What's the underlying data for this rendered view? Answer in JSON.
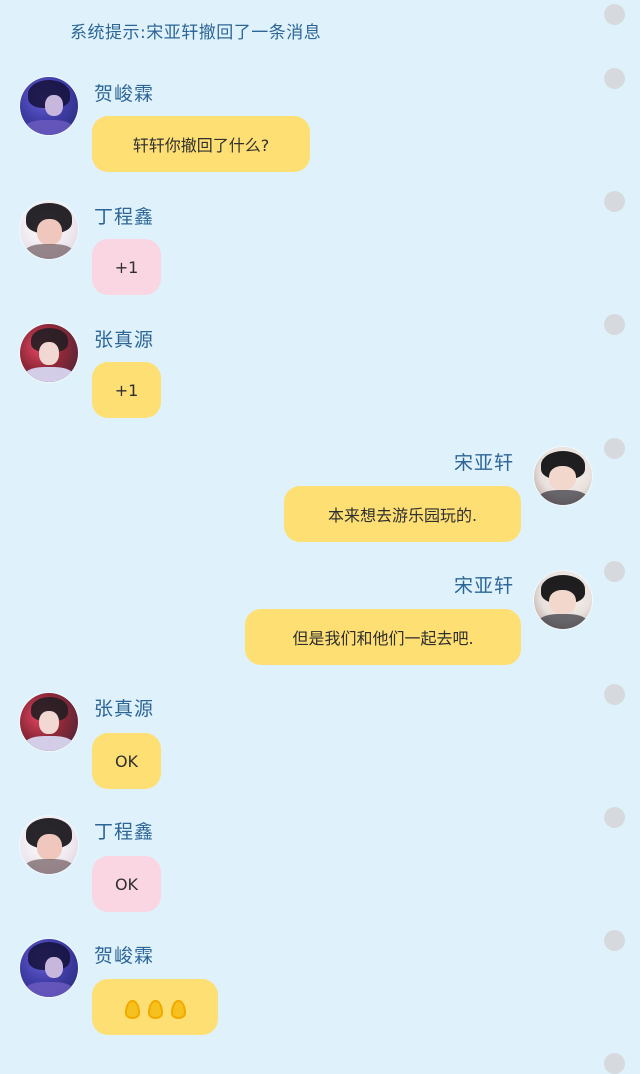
{
  "system_tip": "系统提示:宋亚轩撤回了一条消息",
  "messages": [
    {
      "sender": "贺峻霖",
      "text": "轩轩你撤回了什么?"
    },
    {
      "sender": "丁程鑫",
      "text": "+1"
    },
    {
      "sender": "张真源",
      "text": "+1"
    },
    {
      "sender": "宋亚轩",
      "text": "本来想去游乐园玩的."
    },
    {
      "sender": "宋亚轩",
      "text": "但是我们和他们一起去吧."
    },
    {
      "sender": "张真源",
      "text": "OK"
    },
    {
      "sender": "丁程鑫",
      "text": "OK"
    },
    {
      "sender": "贺峻霖",
      "text": "",
      "icons": [
        "ok-hand-emoji-icon",
        "ok-hand-emoji-icon",
        "ok-hand-emoji-icon"
      ]
    }
  ],
  "colors": {
    "background": "#dff2fb",
    "name_text": "#2d6696",
    "bubble_yellow": "#fddf73",
    "bubble_pink": "#f9d6e2",
    "binder_hole": "#d6dade"
  }
}
